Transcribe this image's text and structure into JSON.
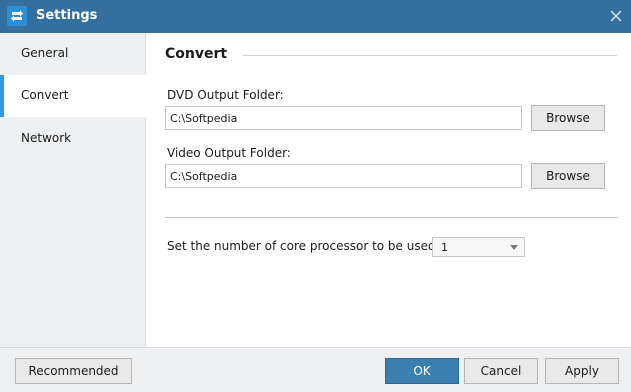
{
  "window": {
    "title": "Settings",
    "app_icon": "app-logo-icon",
    "close_icon": "close-icon"
  },
  "sidebar": {
    "items": [
      {
        "label": "General",
        "active": false
      },
      {
        "label": "Convert",
        "active": true
      },
      {
        "label": "Network",
        "active": false
      }
    ]
  },
  "main": {
    "section_title": "Convert",
    "dvd_output": {
      "label": "DVD Output Folder:",
      "value": "C:\\Softpedia",
      "browse_label": "Browse"
    },
    "video_output": {
      "label": "Video Output Folder:",
      "value": "C:\\Softpedia",
      "browse_label": "Browse"
    },
    "core_processor": {
      "label": "Set the number of core processor to be used:",
      "selected": "1"
    }
  },
  "footer": {
    "recommended_label": "Recommended",
    "ok_label": "OK",
    "cancel_label": "Cancel",
    "apply_label": "Apply"
  },
  "colors": {
    "titlebar": "#33709f",
    "accent": "#3a9ad9",
    "ok_button": "#3b7eb0"
  }
}
